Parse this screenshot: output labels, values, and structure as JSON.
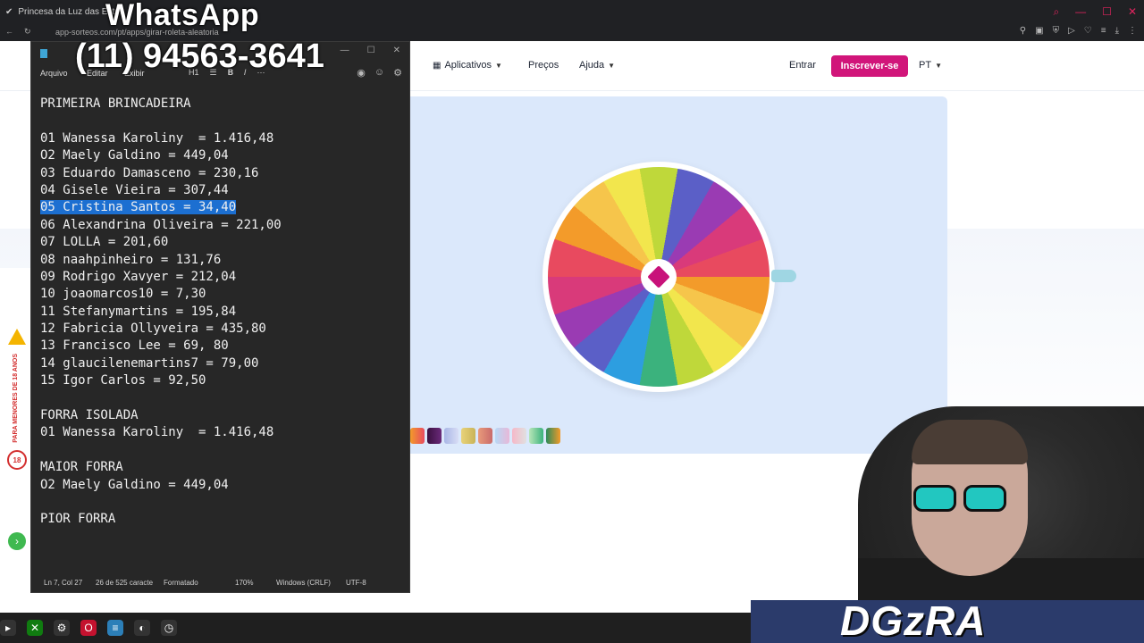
{
  "browser": {
    "tab_title": "Princesa da Luz das Estr...",
    "url": "app-sorteos.com/pt/apps/girar-roleta-aleatoria"
  },
  "site": {
    "nav": {
      "apps": "Aplicativos",
      "prices": "Preços",
      "help": "Ajuda",
      "login": "Entrar",
      "signup": "Inscrever-se",
      "lang": "PT"
    },
    "accent": "#d1157a"
  },
  "overlay": {
    "whatsapp": "WhatsApp",
    "phone": "(11) 94563-3641"
  },
  "notepad": {
    "menu": {
      "file": "Arquivo",
      "edit": "Editar",
      "view": "Exibir",
      "heading": "H1"
    },
    "lines": [
      "PRIMEIRA BRINCADEIRA",
      "",
      "01 Wanessa Karoliny  = 1.416,48",
      "O2 Maely Galdino = 449,04",
      "03 Eduardo Damasceno = 230,16",
      "04 Gisele Vieira = 307,44",
      "05 Cristina Santos = 34,40",
      "06 Alexandrina Oliveira = 221,00",
      "07 LOLLA = 201,60",
      "08 naahpinheiro = 131,76",
      "09 Rodrigo Xavyer = 212,04",
      "10 joaomarcos10 = 7,30",
      "11 Stefanymartins = 195,84",
      "12 Fabricia Ollyveira = 435,80",
      "13 Francisco Lee = 69, 80",
      "14 glaucilenemartins7 = 79,00",
      "15 Igor Carlos = 92,50",
      "",
      "FORRA ISOLADA",
      "01 Wanessa Karoliny  = 1.416,48",
      "",
      "MAIOR FORRA",
      "O2 Maely Galdino = 449,04",
      "",
      "PIOR FORRA"
    ],
    "selected_line": 6,
    "status": {
      "position": "Ln 7, Col 27",
      "chars": "26 de 525 caracte",
      "format": "Formatado",
      "zoom": "170%",
      "eol": "Windows (CRLF)",
      "encoding": "UTF-8"
    }
  },
  "side_strip": {
    "age": "18",
    "vertical_text": "PARA MENORES DE 18 ANOS"
  },
  "brand": {
    "text": "DGzRA"
  }
}
